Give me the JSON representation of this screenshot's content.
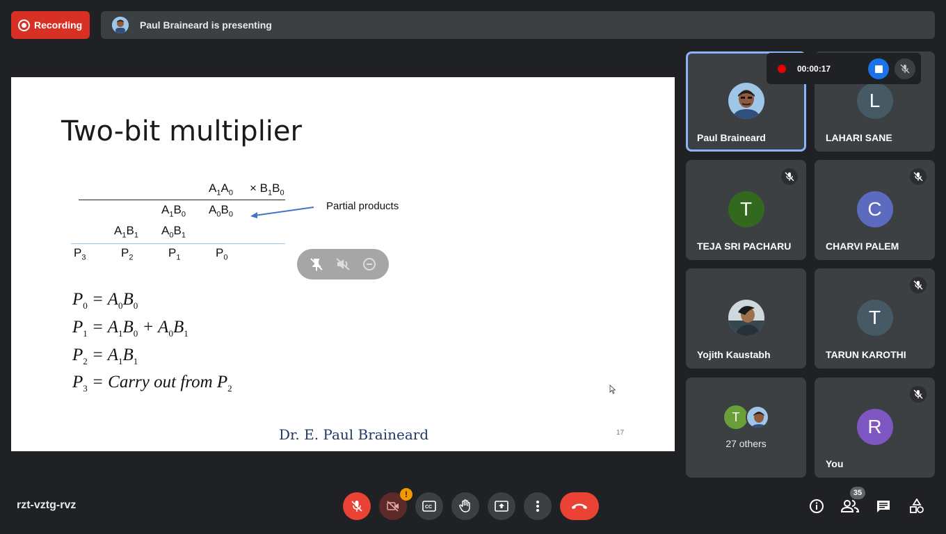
{
  "top": {
    "recording_label": "Recording",
    "presenting_text": "Paul Braineard is presenting"
  },
  "slide": {
    "title": "Two-bit multiplier",
    "table": {
      "r1": [
        {
          "b": "A",
          "s": "1"
        },
        {
          "b": "A",
          "s": "0"
        }
      ],
      "r1_mult": "× B",
      "partial_label": "Partial products",
      "p_labels": [
        "P",
        "P",
        "P",
        "P"
      ],
      "p_subs": [
        "3",
        "2",
        "1",
        "0"
      ]
    },
    "equations": [
      "P0 = A0B0",
      "P1 = A1B0 + A0B1",
      "P2 = A1B1",
      "P3 = Carry out from P2"
    ],
    "eq_parts": {
      "carry": "Carry out  from"
    },
    "signature": "Dr. E. Paul Braineard",
    "page_number": "17"
  },
  "recording_widget": {
    "time": "00:00:17"
  },
  "participants": [
    {
      "name": "Paul Braineard",
      "initial": "",
      "color": "#8ab4f8",
      "muted": false,
      "active": true
    },
    {
      "name": "LAHARI SANE",
      "initial": "L",
      "color": "#455a64",
      "muted": true
    },
    {
      "name": "TEJA SRI PACHARU",
      "initial": "T",
      "color": "#33691e",
      "muted": true
    },
    {
      "name": "CHARVI PALEM",
      "initial": "C",
      "color": "#5c6bc0",
      "muted": true
    },
    {
      "name": "Yojith Kaustabh",
      "initial": "",
      "color": "#5f6368",
      "muted": false
    },
    {
      "name": "TARUN KAROTHI",
      "initial": "T",
      "color": "#455a64",
      "muted": true
    },
    {
      "name": "27 others",
      "initial": "T",
      "color": "#689f38",
      "muted": false
    },
    {
      "name": "You",
      "initial": "R",
      "color": "#7e57c2",
      "muted": true
    }
  ],
  "bottom": {
    "meeting_code": "rzt-vztg-rvz",
    "people_count": "35",
    "camera_warning": "!"
  }
}
